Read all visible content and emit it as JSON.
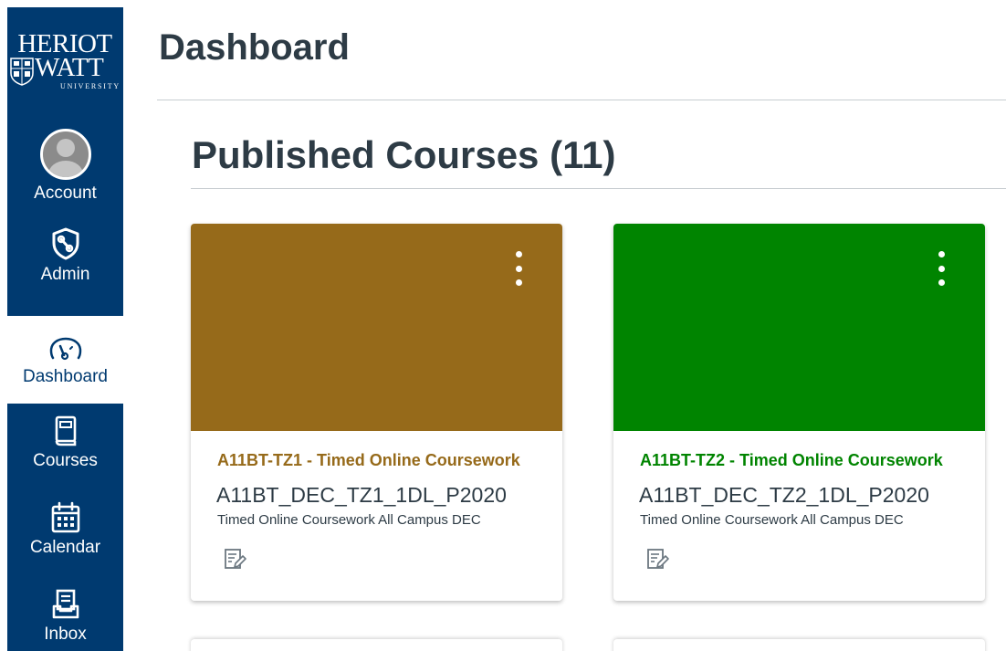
{
  "logo": {
    "line1": "HERIOT",
    "line2": "WATT",
    "line3": "UNIVERSITY"
  },
  "nav": {
    "account": "Account",
    "admin": "Admin",
    "dashboard": "Dashboard",
    "courses": "Courses",
    "calendar": "Calendar",
    "inbox": "Inbox"
  },
  "page": {
    "title": "Dashboard",
    "section_title": "Published Courses (11)"
  },
  "cards": [
    {
      "title": "A11BT-TZ1 - Timed Online Coursework",
      "code": "A11BT_DEC_TZ1_1DL_P2020",
      "term": "Timed Online Coursework All Campus DEC",
      "color": "#966a1a"
    },
    {
      "title": "A11BT-TZ2 - Timed Online Coursework",
      "code": "A11BT_DEC_TZ2_1DL_P2020",
      "term": "Timed Online Coursework All Campus DEC",
      "color": "#008400"
    }
  ],
  "colors": {
    "nav_bg": "#003a70",
    "text": "#2d3b45",
    "divider": "#c7cdd1"
  },
  "icons": [
    "avatar-icon",
    "admin-shield-icon",
    "dashboard-speedometer-icon",
    "courses-book-icon",
    "calendar-icon",
    "inbox-icon",
    "card-options-kebab-icon",
    "assignment-icon"
  ]
}
